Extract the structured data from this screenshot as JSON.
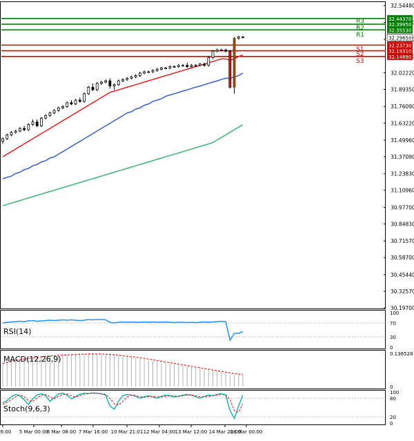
{
  "chart_data": {
    "type": "candlestick",
    "main": {
      "y_ticks": [
        "32.54480",
        "32.41350",
        "32.28220",
        "32.15090",
        "32.02220",
        "31.89350",
        "31.76090",
        "31.63220",
        "31.49960",
        "31.37090",
        "31.23830",
        "31.10960",
        "30.97700",
        "30.84830",
        "30.71570",
        "30.58700",
        "30.45440",
        "30.32570",
        "30.19700"
      ],
      "ylim": [
        30.197,
        32.5448
      ],
      "x_ticks": [
        "4 Mar 16:00",
        "5 Mar 00:00",
        "6 Mar 08:00",
        "7 Mar 16:00",
        "10 Mar 21:01",
        "12 Mar 04:00",
        "13 Mar 12:00",
        "14 Mar 20:00",
        "18 Mar 00:00"
      ],
      "levels": [
        {
          "name": "R3",
          "value": 32.4437,
          "label": "32.44370",
          "color": "#008000"
        },
        {
          "name": "R2",
          "value": 32.3995,
          "label": "32.39950",
          "color": "#008000"
        },
        {
          "name": "R1",
          "value": 32.3553,
          "label": "32.35530",
          "color": "#008000"
        },
        {
          "name": "S1",
          "value": 32.2373,
          "label": "32.23730",
          "color": "#d00000"
        },
        {
          "name": "S2",
          "value": 32.1931,
          "label": "32.19310",
          "color": "#d00000"
        },
        {
          "name": "S3",
          "value": 32.1489,
          "label": "32.14890",
          "color": "#d00000"
        }
      ],
      "current_price": "32.29650",
      "candles": [
        [
          31.49,
          31.52,
          31.47,
          31.51
        ],
        [
          31.51,
          31.55,
          31.5,
          31.54
        ],
        [
          31.54,
          31.57,
          31.53,
          31.56
        ],
        [
          31.56,
          31.58,
          31.55,
          31.57
        ],
        [
          31.57,
          31.6,
          31.56,
          31.59
        ],
        [
          31.59,
          31.61,
          31.57,
          31.58
        ],
        [
          31.58,
          31.63,
          31.57,
          31.62
        ],
        [
          31.62,
          31.66,
          31.61,
          31.64
        ],
        [
          31.64,
          31.66,
          31.6,
          31.61
        ],
        [
          31.61,
          31.68,
          31.6,
          31.67
        ],
        [
          31.67,
          31.7,
          31.66,
          31.69
        ],
        [
          31.69,
          31.72,
          31.68,
          31.71
        ],
        [
          31.71,
          31.74,
          31.7,
          31.73
        ],
        [
          31.73,
          31.76,
          31.72,
          31.75
        ],
        [
          31.75,
          31.77,
          31.74,
          31.76
        ],
        [
          31.76,
          31.8,
          31.75,
          31.79
        ],
        [
          31.79,
          31.81,
          31.77,
          31.78
        ],
        [
          31.78,
          31.82,
          31.77,
          31.81
        ],
        [
          31.81,
          31.83,
          31.79,
          31.8
        ],
        [
          31.8,
          31.87,
          31.79,
          31.86
        ],
        [
          31.86,
          31.92,
          31.85,
          31.91
        ],
        [
          31.91,
          31.94,
          31.88,
          31.89
        ],
        [
          31.89,
          31.95,
          31.88,
          31.94
        ],
        [
          31.94,
          31.96,
          31.93,
          31.95
        ],
        [
          31.95,
          31.97,
          31.94,
          31.96
        ],
        [
          31.96,
          31.98,
          31.9,
          31.92
        ],
        [
          31.92,
          31.94,
          31.89,
          31.93
        ],
        [
          31.93,
          31.97,
          31.92,
          31.96
        ],
        [
          31.96,
          31.98,
          31.95,
          31.97
        ],
        [
          31.97,
          31.99,
          31.96,
          31.98
        ],
        [
          31.98,
          32.0,
          31.97,
          31.99
        ],
        [
          31.99,
          32.01,
          31.98,
          32.0
        ],
        [
          32.0,
          32.03,
          31.99,
          32.02
        ],
        [
          32.02,
          32.04,
          32.01,
          32.03
        ],
        [
          32.03,
          32.04,
          32.02,
          32.03
        ],
        [
          32.03,
          32.05,
          32.02,
          32.04
        ],
        [
          32.04,
          32.06,
          32.03,
          32.05
        ],
        [
          32.05,
          32.07,
          32.04,
          32.06
        ],
        [
          32.06,
          32.07,
          32.05,
          32.06
        ],
        [
          32.06,
          32.08,
          32.05,
          32.07
        ],
        [
          32.07,
          32.08,
          32.06,
          32.07
        ],
        [
          32.07,
          32.09,
          32.06,
          32.08
        ],
        [
          32.08,
          32.09,
          32.07,
          32.08
        ],
        [
          32.08,
          32.1,
          32.06,
          32.07
        ],
        [
          32.07,
          32.09,
          32.06,
          32.08
        ],
        [
          32.08,
          32.09,
          32.07,
          32.08
        ],
        [
          32.08,
          32.1,
          32.07,
          32.09
        ],
        [
          32.09,
          32.1,
          32.07,
          32.08
        ],
        [
          32.08,
          32.15,
          32.07,
          32.14
        ],
        [
          32.14,
          32.2,
          32.13,
          32.19
        ],
        [
          32.19,
          32.21,
          32.18,
          32.2
        ],
        [
          32.2,
          32.21,
          32.19,
          32.2
        ],
        [
          32.2,
          32.21,
          32.18,
          32.19
        ],
        [
          32.19,
          32.2,
          31.9,
          31.91
        ],
        [
          31.91,
          32.3,
          31.86,
          32.29
        ],
        [
          32.29,
          32.31,
          32.28,
          32.3
        ],
        [
          32.3,
          32.31,
          32.29,
          32.3
        ]
      ],
      "ma_red": [
        31.37,
        31.39,
        31.41,
        31.43,
        31.45,
        31.47,
        31.49,
        31.51,
        31.53,
        31.55,
        31.57,
        31.59,
        31.61,
        31.63,
        31.65,
        31.67,
        31.69,
        31.71,
        31.73,
        31.75,
        31.77,
        31.79,
        31.81,
        31.83,
        31.85,
        31.87,
        31.88,
        31.89,
        31.9,
        31.91,
        31.92,
        31.93,
        31.94,
        31.95,
        31.96,
        31.97,
        31.98,
        31.99,
        32.0,
        32.01,
        32.02,
        32.03,
        32.04,
        32.05,
        32.06,
        32.07,
        32.08,
        32.09,
        32.1,
        32.11,
        32.12,
        32.13,
        32.13,
        32.12,
        32.13,
        32.15,
        32.16
      ],
      "ma_blue": [
        31.2,
        31.21,
        31.22,
        31.24,
        31.25,
        31.27,
        31.28,
        31.3,
        31.31,
        31.33,
        31.34,
        31.36,
        31.37,
        31.39,
        31.41,
        31.43,
        31.45,
        31.47,
        31.49,
        31.51,
        31.53,
        31.55,
        31.57,
        31.59,
        31.61,
        31.63,
        31.65,
        31.67,
        31.69,
        31.71,
        31.72,
        31.74,
        31.75,
        31.77,
        31.78,
        31.8,
        31.81,
        31.82,
        31.84,
        31.85,
        31.86,
        31.87,
        31.88,
        31.89,
        31.9,
        31.91,
        31.92,
        31.93,
        31.94,
        31.95,
        31.96,
        31.97,
        31.98,
        31.98,
        31.99,
        32.0,
        32.02
      ],
      "ma_green": [
        30.99,
        31.0,
        31.01,
        31.02,
        31.03,
        31.04,
        31.05,
        31.06,
        31.07,
        31.08,
        31.09,
        31.1,
        31.11,
        31.12,
        31.13,
        31.14,
        31.15,
        31.16,
        31.17,
        31.18,
        31.19,
        31.2,
        31.21,
        31.22,
        31.23,
        31.24,
        31.25,
        31.26,
        31.27,
        31.28,
        31.29,
        31.3,
        31.31,
        31.32,
        31.33,
        31.34,
        31.35,
        31.36,
        31.37,
        31.38,
        31.39,
        31.4,
        31.41,
        31.42,
        31.43,
        31.44,
        31.45,
        31.46,
        31.47,
        31.48,
        31.5,
        31.52,
        31.54,
        31.56,
        31.58,
        31.6,
        31.62
      ]
    },
    "rsi": {
      "label": "RSI(14)",
      "y_ticks": [
        "100",
        "70",
        "30",
        "0"
      ],
      "ylim": [
        0,
        100
      ],
      "values": [
        70,
        72,
        73,
        74,
        75,
        74,
        76,
        77,
        75,
        76,
        77,
        78,
        77,
        78,
        79,
        78,
        79,
        78,
        77,
        78,
        80,
        79,
        80,
        80,
        79,
        72,
        70,
        72,
        73,
        72,
        73,
        72,
        72,
        73,
        72,
        73,
        72,
        72,
        73,
        72,
        71,
        72,
        72,
        71,
        72,
        71,
        72,
        73,
        72,
        73,
        74,
        75,
        74,
        20,
        40,
        40,
        45
      ]
    },
    "macd": {
      "label": "MACD(12,26,9)",
      "y_ticks": [
        "0.136528",
        "0"
      ],
      "ylim": [
        0,
        0.136528
      ],
      "hist": [
        0.1,
        0.104,
        0.108,
        0.111,
        0.114,
        0.117,
        0.119,
        0.121,
        0.123,
        0.125,
        0.127,
        0.128,
        0.129,
        0.13,
        0.131,
        0.132,
        0.133,
        0.134,
        0.134,
        0.135,
        0.136,
        0.135,
        0.135,
        0.134,
        0.133,
        0.131,
        0.129,
        0.127,
        0.125,
        0.123,
        0.121,
        0.118,
        0.115,
        0.112,
        0.109,
        0.106,
        0.103,
        0.1,
        0.097,
        0.094,
        0.091,
        0.088,
        0.085,
        0.082,
        0.079,
        0.076,
        0.073,
        0.07,
        0.067,
        0.064,
        0.061,
        0.058,
        0.055,
        0.046,
        0.047,
        0.048,
        0.049
      ],
      "signal": [
        0.095,
        0.099,
        0.103,
        0.107,
        0.11,
        0.113,
        0.116,
        0.118,
        0.12,
        0.122,
        0.124,
        0.126,
        0.127,
        0.128,
        0.129,
        0.13,
        0.131,
        0.132,
        0.133,
        0.133,
        0.134,
        0.134,
        0.134,
        0.134,
        0.133,
        0.132,
        0.131,
        0.129,
        0.127,
        0.125,
        0.123,
        0.121,
        0.118,
        0.116,
        0.113,
        0.11,
        0.107,
        0.104,
        0.101,
        0.098,
        0.095,
        0.092,
        0.089,
        0.086,
        0.083,
        0.08,
        0.077,
        0.074,
        0.071,
        0.068,
        0.065,
        0.062,
        0.059,
        0.056,
        0.053,
        0.051,
        0.049
      ]
    },
    "stoch": {
      "label": "Stoch(9,6,3)",
      "y_ticks": [
        "100",
        "80",
        "20",
        "0"
      ],
      "ylim": [
        0,
        100
      ],
      "k": [
        65,
        72,
        85,
        92,
        88,
        75,
        60,
        78,
        90,
        95,
        88,
        70,
        82,
        94,
        96,
        90,
        78,
        85,
        93,
        96,
        95,
        97,
        96,
        94,
        90,
        55,
        45,
        70,
        88,
        92,
        90,
        86,
        80,
        85,
        88,
        84,
        80,
        86,
        90,
        88,
        84,
        86,
        90,
        92,
        90,
        85,
        80,
        86,
        90,
        88,
        92,
        95,
        90,
        40,
        15,
        55,
        90
      ],
      "d": [
        60,
        66,
        75,
        85,
        90,
        85,
        72,
        70,
        80,
        90,
        92,
        84,
        78,
        86,
        92,
        94,
        88,
        84,
        88,
        92,
        95,
        96,
        96,
        95,
        92,
        80,
        62,
        58,
        70,
        84,
        90,
        89,
        85,
        83,
        85,
        86,
        84,
        84,
        86,
        88,
        87,
        86,
        88,
        90,
        90,
        88,
        85,
        84,
        86,
        88,
        90,
        92,
        92,
        75,
        40,
        35,
        62
      ]
    }
  }
}
